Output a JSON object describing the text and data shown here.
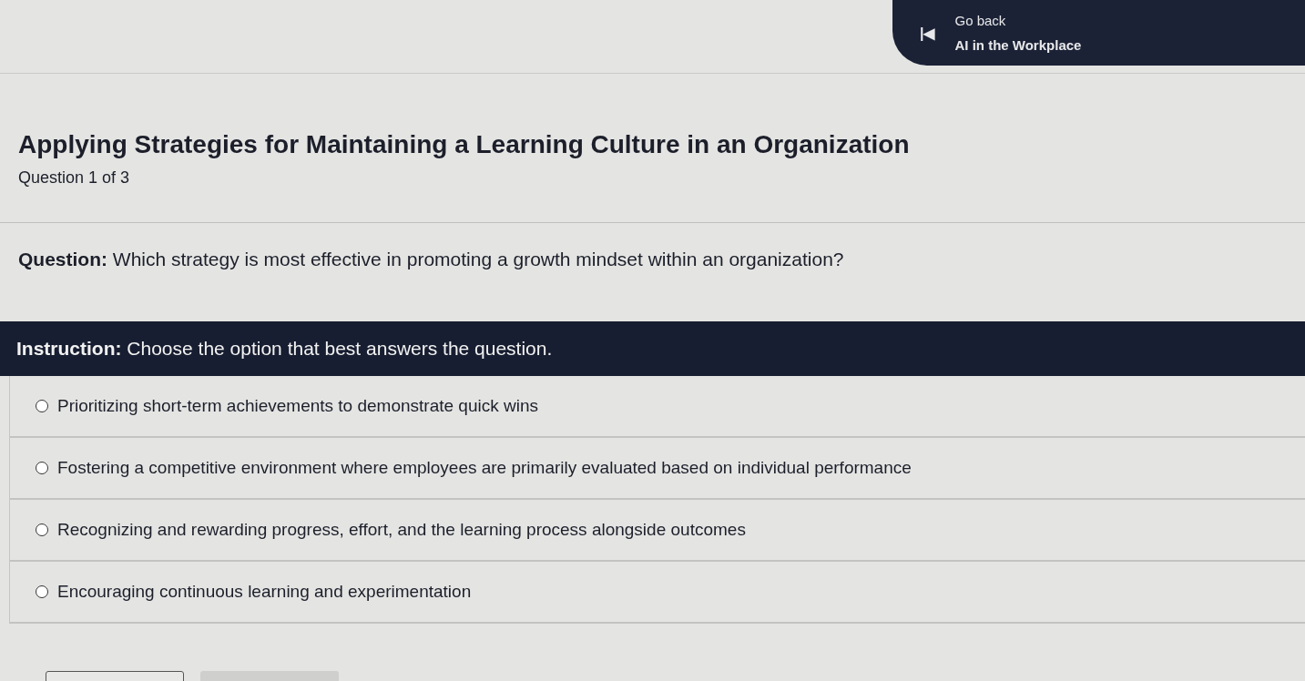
{
  "header": {
    "icon": "|◀",
    "back_label": "Go back",
    "course_title": "AI in the Workplace"
  },
  "title": "Applying Strategies for Maintaining a Learning Culture in an Organization",
  "progress": "Question 1 of 3",
  "question": "**Question:** Which strategy is most effective in promoting a growth mindset within an organization?",
  "instruction": "**Instruction:** Choose the option that best answers the question.",
  "options": [
    {
      "label": "Prioritizing short-term achievements to demonstrate quick wins",
      "selected": false
    },
    {
      "label": "Fostering a competitive environment where employees are primarily evaluated based on individual performance",
      "selected": false
    },
    {
      "label": "Recognizing and rewarding progress, effort, and the learning process alongside outcomes",
      "selected": false
    },
    {
      "label": "Encouraging continuous learning and experimentation",
      "selected": false
    }
  ],
  "buttons": [
    {
      "kind": "outline"
    },
    {
      "kind": "filled"
    }
  ]
}
